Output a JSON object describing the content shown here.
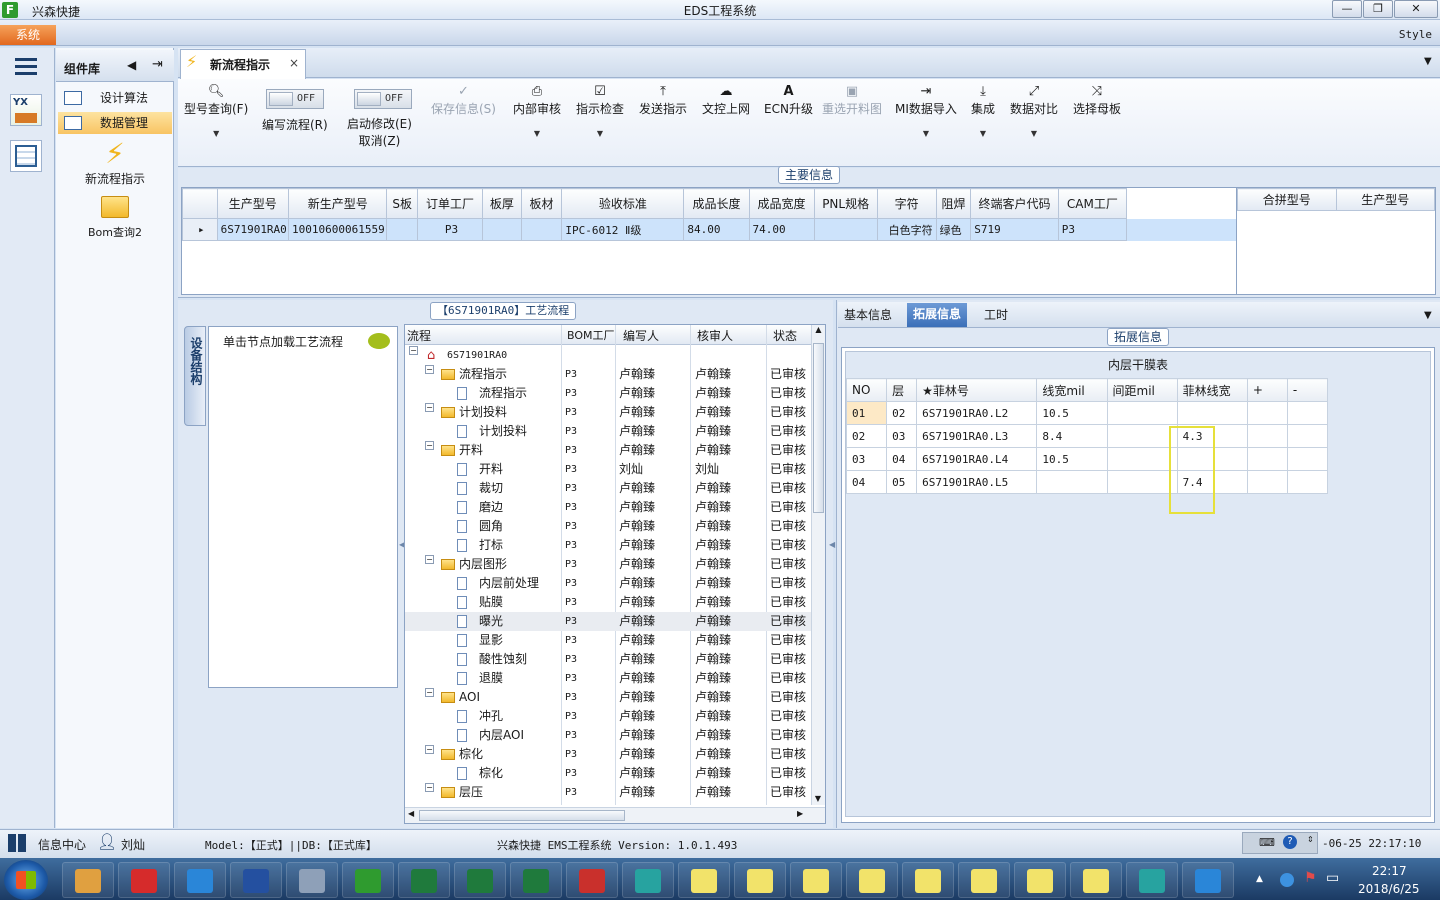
{
  "window": {
    "app_name": "兴森快捷",
    "title": "EDS工程系统",
    "minimize": "—",
    "restore": "❐",
    "close": "✕"
  },
  "ribbon": {
    "system_button": "系统",
    "style_label": "Style"
  },
  "sidebar": {
    "title": "组件库",
    "items": [
      {
        "label": "设计算法",
        "selected": false
      },
      {
        "label": "数据管理",
        "selected": true
      }
    ],
    "shortcuts": [
      {
        "label": "新流程指示",
        "icon": "lightning-icon"
      },
      {
        "label": "Bom查询2",
        "icon": "folder-icon"
      }
    ]
  },
  "document_tab": {
    "label": "新流程指示",
    "close": "×"
  },
  "toolbar": {
    "items": [
      {
        "label": "型号查询(F)",
        "icon": "search-icon",
        "enabled": true
      },
      {
        "label": "编写流程(R)",
        "toggle": "OFF",
        "enabled": true
      },
      {
        "label": "启动修改(E)",
        "label2": "取消(Z)",
        "toggle": "OFF",
        "enabled": true
      },
      {
        "label": "保存信息(S)",
        "icon": "check-icon",
        "enabled": false
      },
      {
        "label": "内部审核",
        "icon": "printer-icon",
        "enabled": true
      },
      {
        "label": "指示检查",
        "icon": "checkbox-icon",
        "enabled": true
      },
      {
        "label": "发送指示",
        "icon": "upload-icon",
        "enabled": true
      },
      {
        "label": "文控上网",
        "icon": "cloud-upload-icon",
        "enabled": true
      },
      {
        "label": "ECN升级",
        "icon": "letter-a-icon",
        "enabled": true
      },
      {
        "label": "重选开料图",
        "icon": "image-icon",
        "enabled": false
      },
      {
        "label": "MI数据导入",
        "icon": "import-icon",
        "enabled": true
      },
      {
        "label": "集成",
        "icon": "download-icon",
        "enabled": true
      },
      {
        "label": "数据对比",
        "icon": "compare-icon",
        "enabled": true
      },
      {
        "label": "选择母板",
        "icon": "shuffle-icon",
        "enabled": true
      }
    ]
  },
  "main_info": {
    "group_label": "主要信息",
    "columns": [
      "生产型号",
      "新生产型号",
      "S板",
      "订单工厂",
      "板厚",
      "板材",
      "验收标准",
      "成品长度",
      "成品宽度",
      "PNL规格",
      "字符",
      "阻焊",
      "终端客户代码",
      "CAM工厂"
    ],
    "rows": [
      [
        "6S71901RA0",
        "10010600061559",
        "",
        "P3",
        "",
        "",
        "IPC-6012 Ⅱ级",
        "84.00",
        "74.00",
        "",
        "白色字符",
        "绿色",
        "S719",
        "P3"
      ]
    ],
    "side_columns": [
      "合拼型号",
      "生产型号"
    ]
  },
  "process_panel": {
    "group_label": "【6S71901RA0】工艺流程",
    "side_tab": "设备结构",
    "hint": "单击节点加载工艺流程",
    "columns": [
      "流程",
      "BOM工厂",
      "编写人",
      "核审人",
      "状态"
    ],
    "root": "6S71901RA0",
    "rows": [
      {
        "name": "流程指示",
        "level": 1,
        "bom": "P3",
        "writer": "卢翰臻",
        "reviewer": "卢翰臻",
        "status": "已审核"
      },
      {
        "name": "流程指示",
        "level": 2,
        "bom": "P3",
        "writer": "卢翰臻",
        "reviewer": "卢翰臻",
        "status": "已审核"
      },
      {
        "name": "计划投料",
        "level": 1,
        "bom": "P3",
        "writer": "卢翰臻",
        "reviewer": "卢翰臻",
        "status": "已审核"
      },
      {
        "name": "计划投料",
        "level": 2,
        "bom": "P3",
        "writer": "卢翰臻",
        "reviewer": "卢翰臻",
        "status": "已审核"
      },
      {
        "name": "开料",
        "level": 1,
        "bom": "P3",
        "writer": "卢翰臻",
        "reviewer": "卢翰臻",
        "status": "已审核"
      },
      {
        "name": "开料",
        "level": 2,
        "bom": "P3",
        "writer": "刘灿",
        "reviewer": "刘灿",
        "status": "已审核"
      },
      {
        "name": "裁切",
        "level": 2,
        "bom": "P3",
        "writer": "卢翰臻",
        "reviewer": "卢翰臻",
        "status": "已审核"
      },
      {
        "name": "磨边",
        "level": 2,
        "bom": "P3",
        "writer": "卢翰臻",
        "reviewer": "卢翰臻",
        "status": "已审核"
      },
      {
        "name": "圆角",
        "level": 2,
        "bom": "P3",
        "writer": "卢翰臻",
        "reviewer": "卢翰臻",
        "status": "已审核"
      },
      {
        "name": "打标",
        "level": 2,
        "bom": "P3",
        "writer": "卢翰臻",
        "reviewer": "卢翰臻",
        "status": "已审核"
      },
      {
        "name": "内层图形",
        "level": 1,
        "bom": "P3",
        "writer": "卢翰臻",
        "reviewer": "卢翰臻",
        "status": "已审核"
      },
      {
        "name": "内层前处理",
        "level": 2,
        "bom": "P3",
        "writer": "卢翰臻",
        "reviewer": "卢翰臻",
        "status": "已审核"
      },
      {
        "name": "贴膜",
        "level": 2,
        "bom": "P3",
        "writer": "卢翰臻",
        "reviewer": "卢翰臻",
        "status": "已审核"
      },
      {
        "name": "曝光",
        "level": 2,
        "bom": "P3",
        "writer": "卢翰臻",
        "reviewer": "卢翰臻",
        "status": "已审核",
        "highlight": true
      },
      {
        "name": "显影",
        "level": 2,
        "bom": "P3",
        "writer": "卢翰臻",
        "reviewer": "卢翰臻",
        "status": "已审核"
      },
      {
        "name": "酸性蚀刻",
        "level": 2,
        "bom": "P3",
        "writer": "卢翰臻",
        "reviewer": "卢翰臻",
        "status": "已审核"
      },
      {
        "name": "退膜",
        "level": 2,
        "bom": "P3",
        "writer": "卢翰臻",
        "reviewer": "卢翰臻",
        "status": "已审核"
      },
      {
        "name": "AOI",
        "level": 1,
        "bom": "P3",
        "writer": "卢翰臻",
        "reviewer": "卢翰臻",
        "status": "已审核"
      },
      {
        "name": "冲孔",
        "level": 2,
        "bom": "P3",
        "writer": "卢翰臻",
        "reviewer": "卢翰臻",
        "status": "已审核"
      },
      {
        "name": "内层AOI",
        "level": 2,
        "bom": "P3",
        "writer": "卢翰臻",
        "reviewer": "卢翰臻",
        "status": "已审核"
      },
      {
        "name": "棕化",
        "level": 1,
        "bom": "P3",
        "writer": "卢翰臻",
        "reviewer": "卢翰臻",
        "status": "已审核"
      },
      {
        "name": "棕化",
        "level": 2,
        "bom": "P3",
        "writer": "卢翰臻",
        "reviewer": "卢翰臻",
        "status": "已审核"
      },
      {
        "name": "层压",
        "level": 1,
        "bom": "P3",
        "writer": "卢翰臻",
        "reviewer": "卢翰臻",
        "status": "已审核"
      }
    ]
  },
  "detail_panel": {
    "tabs": [
      {
        "label": "基本信息",
        "selected": false
      },
      {
        "label": "拓展信息",
        "selected": true
      },
      {
        "label": "工时",
        "selected": false
      }
    ],
    "group_label": "拓展信息",
    "table_title": "内层干膜表",
    "columns": [
      "NO",
      "层",
      "★菲林号",
      "线宽mil",
      "间距mil",
      "菲林线宽",
      "+",
      "-"
    ],
    "rows": [
      [
        "01",
        "02",
        "6S71901RA0.L2",
        "10.5",
        "",
        "",
        "",
        ""
      ],
      [
        "02",
        "03",
        "6S71901RA0.L3",
        "8.4",
        "",
        "4.3",
        "",
        ""
      ],
      [
        "03",
        "04",
        "6S71901RA0.L4",
        "10.5",
        "",
        "",
        "",
        ""
      ],
      [
        "04",
        "05",
        "6S71901RA0.L5",
        "",
        "",
        "7.4",
        "",
        ""
      ]
    ]
  },
  "statusbar": {
    "info_center": "信息中心",
    "user": "刘灿",
    "model": "Model:【正式】||DB:【正式库】",
    "product": "兴森快捷 EMS工程系统 Version: 1.0.1.493",
    "datetime": "-06-25 22:17:10"
  },
  "taskbar": {
    "time": "22:17",
    "date": "2018/6/25",
    "apps": [
      "shell-icon",
      "g-app-icon",
      "ie-icon",
      "save-icon",
      "scanner-icon",
      "f-app-icon",
      "excel-icon",
      "excel-icon",
      "excel-icon",
      "pdf-icon",
      "eye-icon",
      "x-app-icon",
      "x-app-icon",
      "x-app-icon",
      "x-app-icon",
      "x-app-icon",
      "x-app-icon",
      "x-app-icon",
      "x-app-icon",
      "eye-icon",
      "bird-icon"
    ]
  }
}
